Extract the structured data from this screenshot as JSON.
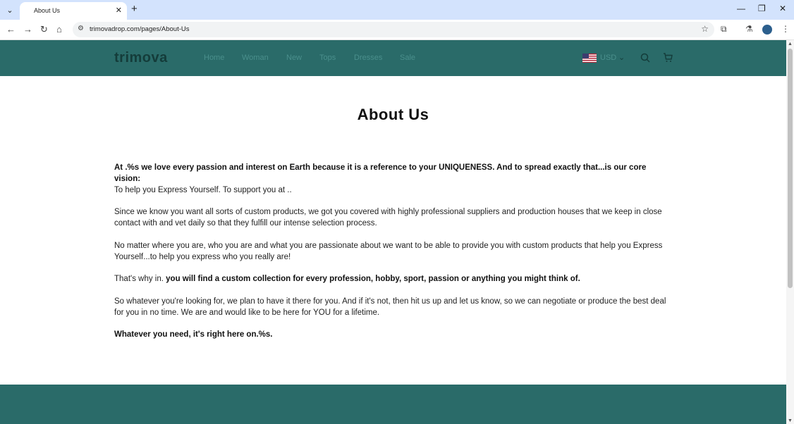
{
  "browser": {
    "tab_title": "About Us",
    "url": "trimovadrop.com/pages/About-Us"
  },
  "site": {
    "logo": "trimova",
    "nav": [
      "Home",
      "Woman",
      "New",
      "Tops",
      "Dresses",
      "Sale"
    ],
    "currency": "USD"
  },
  "page": {
    "title": "About Us",
    "p1": "At .%s we love every passion and interest on Earth because it is a reference to your UNIQUENESS. And to spread exactly that...is our core vision:",
    "p2": "To help you Express Yourself. To support you at ..",
    "p3": "Since we know you want all sorts of custom products, we got you covered with highly professional suppliers and production houses that we keep in close contact with and vet daily so that they fulfill our intense selection process.",
    "p4": "No matter where you are, who you are and what you are passionate about we want to be able to provide you with custom products that help you Express Yourself...to help you express who you really are!",
    "p5_plain": "That's why in.",
    "p5_bold": "you will find a custom collection for every profession, hobby, sport, passion or anything you might think of.",
    "p6": "So whatever you're looking for, we plan to have it there for you. And if it's not, then hit us up and let us know, so we can negotiate or produce the best deal for you in no time. We are and would like to be here for YOU for a lifetime.",
    "p7": "Whatever you need, it's right here on.%s."
  },
  "colors": {
    "header_bg": "#2a6b69",
    "footer_bg": "#2a6b69",
    "tab_strip": "#d3e3fd"
  }
}
